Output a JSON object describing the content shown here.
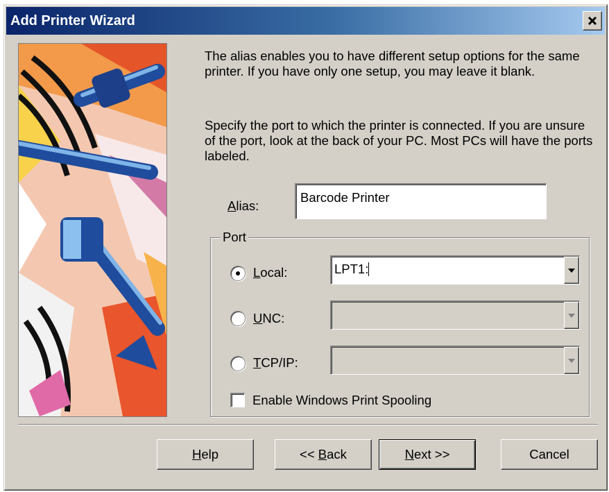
{
  "window": {
    "title": "Add Printer Wizard",
    "close_icon": "close-icon"
  },
  "description": {
    "paragraph1": "The alias enables you to have different setup options for the same printer.  If you have only one setup, you may leave it blank.",
    "paragraph2": "Specify the port to which the printer is connected.  If you are unsure of the port, look at the back of your PC.  Most PCs will have the ports labeled."
  },
  "alias": {
    "label_mnemonic": "A",
    "label_rest": "lias:",
    "value": "Barcode Printer"
  },
  "port": {
    "group_label": "Port",
    "options": [
      {
        "mnemonic": "L",
        "rest": "ocal:",
        "selected": true,
        "value": "LPT1:",
        "enabled": true
      },
      {
        "mnemonic": "U",
        "rest": "NC:",
        "selected": false,
        "value": "",
        "enabled": false
      },
      {
        "mnemonic": "T",
        "rest": "CP/IP:",
        "selected": false,
        "value": "",
        "enabled": false
      }
    ],
    "spooling": {
      "label": "Enable Windows Print Spooling",
      "checked": false
    }
  },
  "buttons": {
    "help": {
      "mnemonic": "H",
      "rest": "elp"
    },
    "back": {
      "prefix": "<< ",
      "mnemonic": "B",
      "rest": "ack"
    },
    "next": {
      "mnemonic": "N",
      "rest": "ext >>"
    },
    "cancel": "Cancel"
  },
  "colors": {
    "title_start": "#0a246a",
    "title_end": "#a6caf0",
    "face": "#d4d0c8"
  }
}
